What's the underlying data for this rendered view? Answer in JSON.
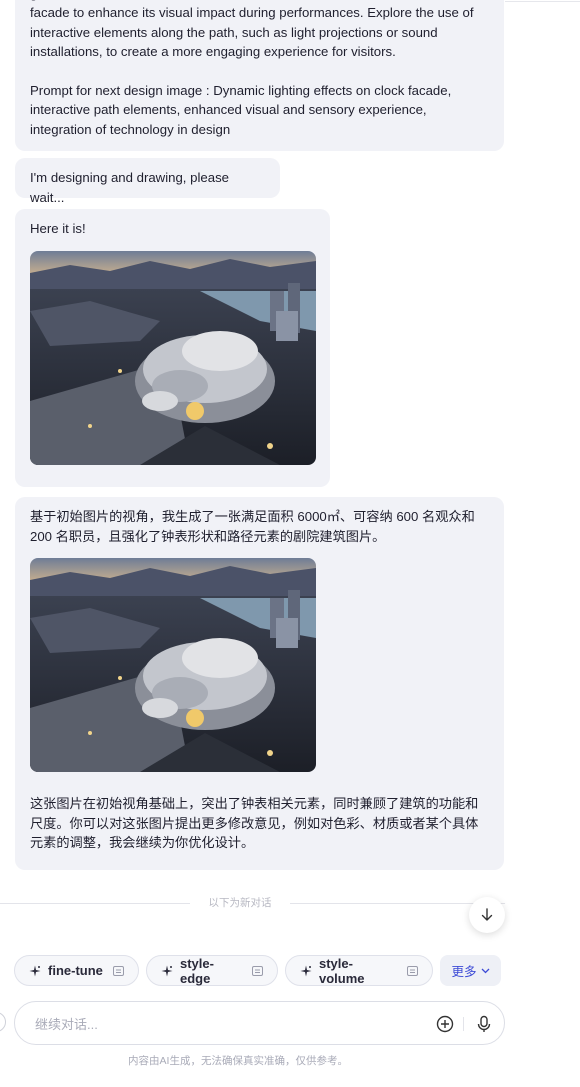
{
  "messages": {
    "prompt_message": {
      "cut_line": "gn",
      "paragraph1": "facade to enhance its visual impact during performances. Explore the use of interactive elements along the path, such as light projections or sound installations, to create a more engaging experience for visitors.",
      "paragraph2": "Prompt for next design image : Dynamic lighting effects on clock facade, interactive path elements, enhanced visual and sensory experience, integration of technology in design"
    },
    "status_message": "I'm designing and drawing, please wait...",
    "image_message": {
      "text": "Here it is!"
    },
    "result_message": {
      "intro": "基于初始图片的视角，我生成了一张满足面积 6000㎡、可容纳 600 名观众和 200 名职员，且强化了钟表形状和路径元素的剧院建筑图片。",
      "outro": "这张图片在初始视角基础上，突出了钟表相关元素，同时兼顾了建筑的功能和尺度。你可以对这张图片提出更多修改意见，例如对色彩、材质或者某个具体元素的调整，我会继续为你优化设计。"
    }
  },
  "divider": {
    "label": "以下为新对话"
  },
  "suggestions": [
    {
      "label": "fine-tune"
    },
    {
      "label": "style-edge"
    },
    {
      "label": "style-volume"
    }
  ],
  "more_label": "更多",
  "input": {
    "placeholder": "继续对话..."
  },
  "disclaimer": "内容由AI生成，无法确保真实准确，仅供参考。",
  "icons": {
    "scroll_down": "arrow-down-icon",
    "suggestion": "sparkle-icon",
    "tag": "tag-icon",
    "more": "chevron-down-icon",
    "attach": "plus-circle-icon",
    "voice": "microphone-icon"
  },
  "colors": {
    "bubble_bg": "#f1f2f7",
    "accent": "#3d4bd6",
    "muted": "#a9abb8"
  }
}
